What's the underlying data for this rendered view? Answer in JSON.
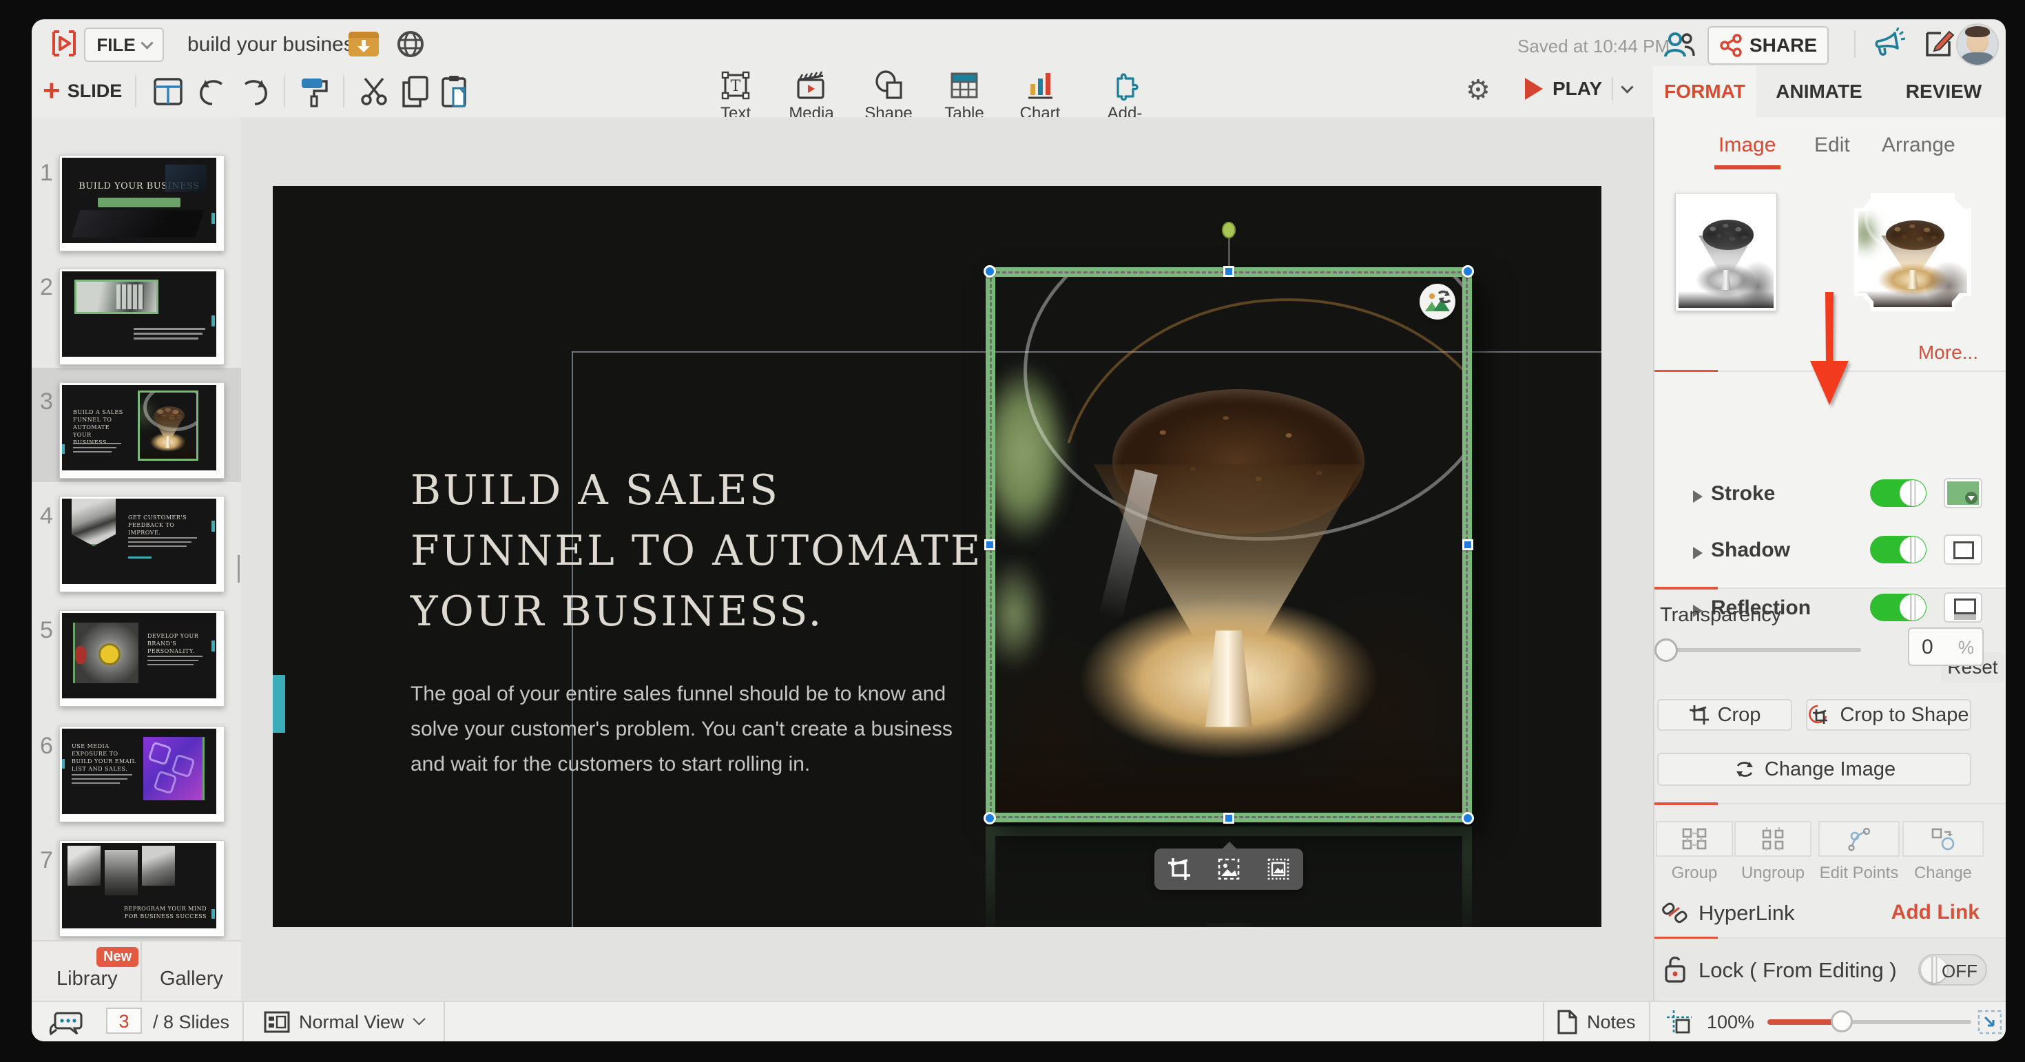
{
  "app": {
    "title": "build your business",
    "saved": "Saved at 10:44 PM",
    "file_menu": "FILE",
    "share": "SHARE",
    "slide_button": "SLIDE",
    "play": "PLAY"
  },
  "insert_tools": {
    "text": "Text",
    "media": "Media",
    "shape": "Shape",
    "table": "Table",
    "chart": "Chart",
    "addons": "Add-Ons"
  },
  "tabs": {
    "format": "FORMAT",
    "animate": "ANIMATE",
    "review": "REVIEW"
  },
  "subtabs": {
    "image": "Image",
    "edit": "Edit",
    "arrange": "Arrange",
    "more": "More..."
  },
  "panel": {
    "stroke": "Stroke",
    "shadow": "Shadow",
    "reflection": "Reflection",
    "reset": "Reset",
    "transparency": "Transparency",
    "transparency_value": "0",
    "percent_suffix": "%",
    "crop": "Crop",
    "crop_to_shape": "Crop to Shape",
    "change_image": "Change Image",
    "group": "Group",
    "ungroup": "Ungroup",
    "edit_points": "Edit Points",
    "change": "Change",
    "hyperlink": "HyperLink",
    "add_link": "Add Link",
    "lock": "Lock ( From Editing )",
    "lock_state": "OFF"
  },
  "sidebar": {
    "library": "Library",
    "library_badge": "New",
    "gallery": "Gallery",
    "slides": [
      {
        "num": "1",
        "title": "BUILD YOUR BUSINESS"
      },
      {
        "num": "2",
        "title": ""
      },
      {
        "num": "3",
        "title": "BUILD A SALES FUNNEL TO AUTOMATE YOUR BUSINESS."
      },
      {
        "num": "4",
        "title": "GET CUSTOMER'S FEEDBACK  TO IMPROVE."
      },
      {
        "num": "5",
        "title": "DEVELOP YOUR BRAND'S  PERSONALITY."
      },
      {
        "num": "6",
        "title": "USE MEDIA EXPOSURE TO BUILD YOUR EMAIL LIST AND SALES."
      },
      {
        "num": "7",
        "title": "REPROGRAM YOUR MIND FOR BUSINESS SUCCESS"
      }
    ]
  },
  "statusbar": {
    "current_slide": "3",
    "slide_total": "/ 8 Slides",
    "view": "Normal View",
    "notes": "Notes",
    "zoom": "100%"
  },
  "slide": {
    "title_lines": [
      "BUILD A SALES",
      "FUNNEL TO AUTOMATE",
      "YOUR BUSINESS."
    ],
    "body": "The goal of your entire sales funnel should be to know and solve your customer's problem. You can't create a business  and wait for the customers  to start rolling in."
  },
  "colors": {
    "accent_red": "#e2492f",
    "teal_icon": "#1d7f99",
    "toggle_green": "#2ebd2e",
    "selection_green": "#7cb87b",
    "stroke_swatch": "#7cb77c",
    "handle_blue": "#1c7fe0"
  }
}
